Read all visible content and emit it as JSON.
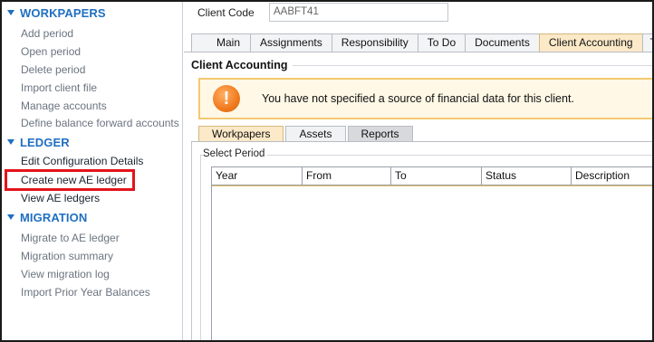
{
  "sidebar": {
    "sections": [
      {
        "title": "WORKPAPERS",
        "items": [
          "Add period",
          "Open period",
          "Delete period",
          "Import client file",
          "Manage accounts",
          "Define balance forward accounts"
        ]
      },
      {
        "title": "LEDGER",
        "items": [
          "Edit Configuration Details",
          "Create new AE ledger",
          "View AE ledgers"
        ]
      },
      {
        "title": "MIGRATION",
        "items": [
          "Migrate to AE ledger",
          "Migration summary",
          "View migration log",
          "Import Prior Year Balances"
        ]
      }
    ]
  },
  "client": {
    "code_label": "Client Code",
    "code_value": "AABFT41"
  },
  "tabs": [
    "Main",
    "Assignments",
    "Responsibility",
    "To Do",
    "Documents",
    "Client Accounting",
    "T"
  ],
  "active_tab": "Client Accounting",
  "section_title": "Client Accounting",
  "alert": {
    "icon": "exclamation-icon",
    "message": "You have not specified a source of financial data for this client."
  },
  "subtabs": [
    "Workpapers",
    "Assets",
    "Reports"
  ],
  "active_subtab": "Workpapers",
  "period_group_label": "Select Period",
  "grid_columns": [
    "Year",
    "From",
    "To",
    "Status",
    "Description"
  ],
  "colors": {
    "accent": "#1f6fc1",
    "highlight": "#e3141b",
    "alert_border": "#f3c970",
    "active_tab": "#fbe9c8"
  }
}
